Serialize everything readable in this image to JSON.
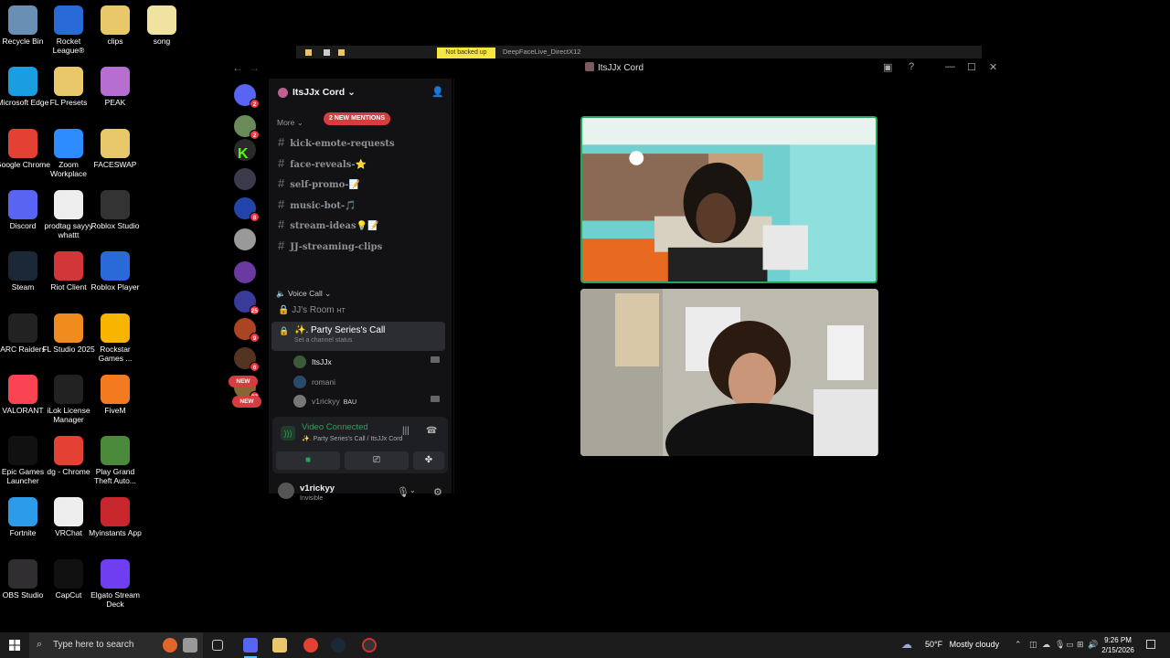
{
  "desktop_icons": [
    {
      "label": "Recycle Bin",
      "icon": "recycle-bin-icon",
      "color": "#6a8fb5"
    },
    {
      "label": "Rocket League®",
      "icon": "rocket-league-icon",
      "color": "#2a6ad8"
    },
    {
      "label": "clips",
      "icon": "folder-icon",
      "color": "#e8c86b"
    },
    {
      "label": "song",
      "icon": "file-icon",
      "color": "#f0e2a0"
    },
    {
      "label": "Microsoft Edge",
      "icon": "edge-icon",
      "color": "#1b9de2"
    },
    {
      "label": "FL Presets",
      "icon": "folder-icon",
      "color": "#e8c86b"
    },
    {
      "label": "PEAK",
      "icon": "peak-icon",
      "color": "#b66fd0"
    },
    {
      "label": "Google Chrome",
      "icon": "chrome-icon",
      "color": "#e34133"
    },
    {
      "label": "Zoom Workplace",
      "icon": "zoom-icon",
      "color": "#2d8cff"
    },
    {
      "label": "FACESWAP",
      "icon": "folder-icon",
      "color": "#e8c86b"
    },
    {
      "label": "Discord",
      "icon": "discord-icon",
      "color": "#5865f2"
    },
    {
      "label": "prodtag sayyy whattt",
      "icon": "audio-file-icon",
      "color": "#eeeeee"
    },
    {
      "label": "Roblox Studio",
      "icon": "roblox-studio-icon",
      "color": "#333333"
    },
    {
      "label": "Steam",
      "icon": "steam-icon",
      "color": "#1b2838"
    },
    {
      "label": "Riot Client",
      "icon": "riot-icon",
      "color": "#d13639"
    },
    {
      "label": "Roblox Player",
      "icon": "roblox-icon",
      "color": "#2a6ad8"
    },
    {
      "label": "ARC Raiders",
      "icon": "arc-raiders-icon",
      "color": "#222222"
    },
    {
      "label": "FL Studio 2025",
      "icon": "fl-studio-icon",
      "color": "#f28b1d"
    },
    {
      "label": "Rockstar Games ...",
      "icon": "rockstar-icon",
      "color": "#f7b500"
    },
    {
      "label": "VALORANT",
      "icon": "valorant-icon",
      "color": "#fa4454"
    },
    {
      "label": "iLok License Manager",
      "icon": "ilok-icon",
      "color": "#222222"
    },
    {
      "label": "FiveM",
      "icon": "fivem-icon",
      "color": "#f47a20"
    },
    {
      "label": "Epic Games Launcher",
      "icon": "epic-games-icon",
      "color": "#111111"
    },
    {
      "label": "dg - Chrome",
      "icon": "chrome-icon",
      "color": "#e34133"
    },
    {
      "label": "Play Grand Theft Auto...",
      "icon": "gta-icon",
      "color": "#4a8a3a"
    },
    {
      "label": "Fortnite",
      "icon": "fortnite-icon",
      "color": "#2c9be8"
    },
    {
      "label": "VRChat",
      "icon": "vrchat-icon",
      "color": "#eeeeee"
    },
    {
      "label": "Myinstants App",
      "icon": "myinstants-icon",
      "color": "#c8262d"
    },
    {
      "label": "OBS Studio",
      "icon": "obs-icon",
      "color": "#302e31"
    },
    {
      "label": "CapCut",
      "icon": "capcut-icon",
      "color": "#111111"
    },
    {
      "label": "Elgato Stream Deck",
      "icon": "stream-deck-icon",
      "color": "#6e3ef0"
    }
  ],
  "background_window": {
    "highlight": "Not backed up",
    "title": "DeepFaceLive_DirectX12"
  },
  "discord": {
    "window_title": "ItsJJx Cord",
    "server_name": "ItsJJx Cord",
    "more_label": "More",
    "mentions_pill": "2 NEW MENTIONS",
    "guild_badges": [
      "2",
      "2",
      "",
      "",
      "8",
      "",
      "",
      "25",
      "9",
      "6",
      "27"
    ],
    "new_pill": "NEW",
    "channels": [
      "kick-emote-requests",
      "face-reveals-⭐",
      "self-promo-📝",
      "music-bot-🎵",
      "stream-ideas💡📝",
      "JJ-streaming-clips"
    ],
    "voice_category": "Voice Call",
    "voice_channels": [
      {
        "name": "JJ's Room",
        "tag": "HT"
      },
      {
        "name": ". Party Series's Call",
        "status_placeholder": "Set a channel status"
      }
    ],
    "voice_members": [
      {
        "name": "ItsJJx",
        "tag": ""
      },
      {
        "name": "romani",
        "tag": ""
      },
      {
        "name": "v1rickyy",
        "tag": "BAU"
      }
    ],
    "rtc": {
      "status": "Video Connected",
      "location": ". Party Series's Call / ItsJJx Cord"
    },
    "user": {
      "name": "v1rickyy",
      "status": "Invisible"
    }
  },
  "taskbar": {
    "search_placeholder": "Type here to search",
    "weather_temp": "50°F",
    "weather_desc": "Mostly cloudy",
    "time": "9:26 PM",
    "date": "2/15/2026"
  }
}
